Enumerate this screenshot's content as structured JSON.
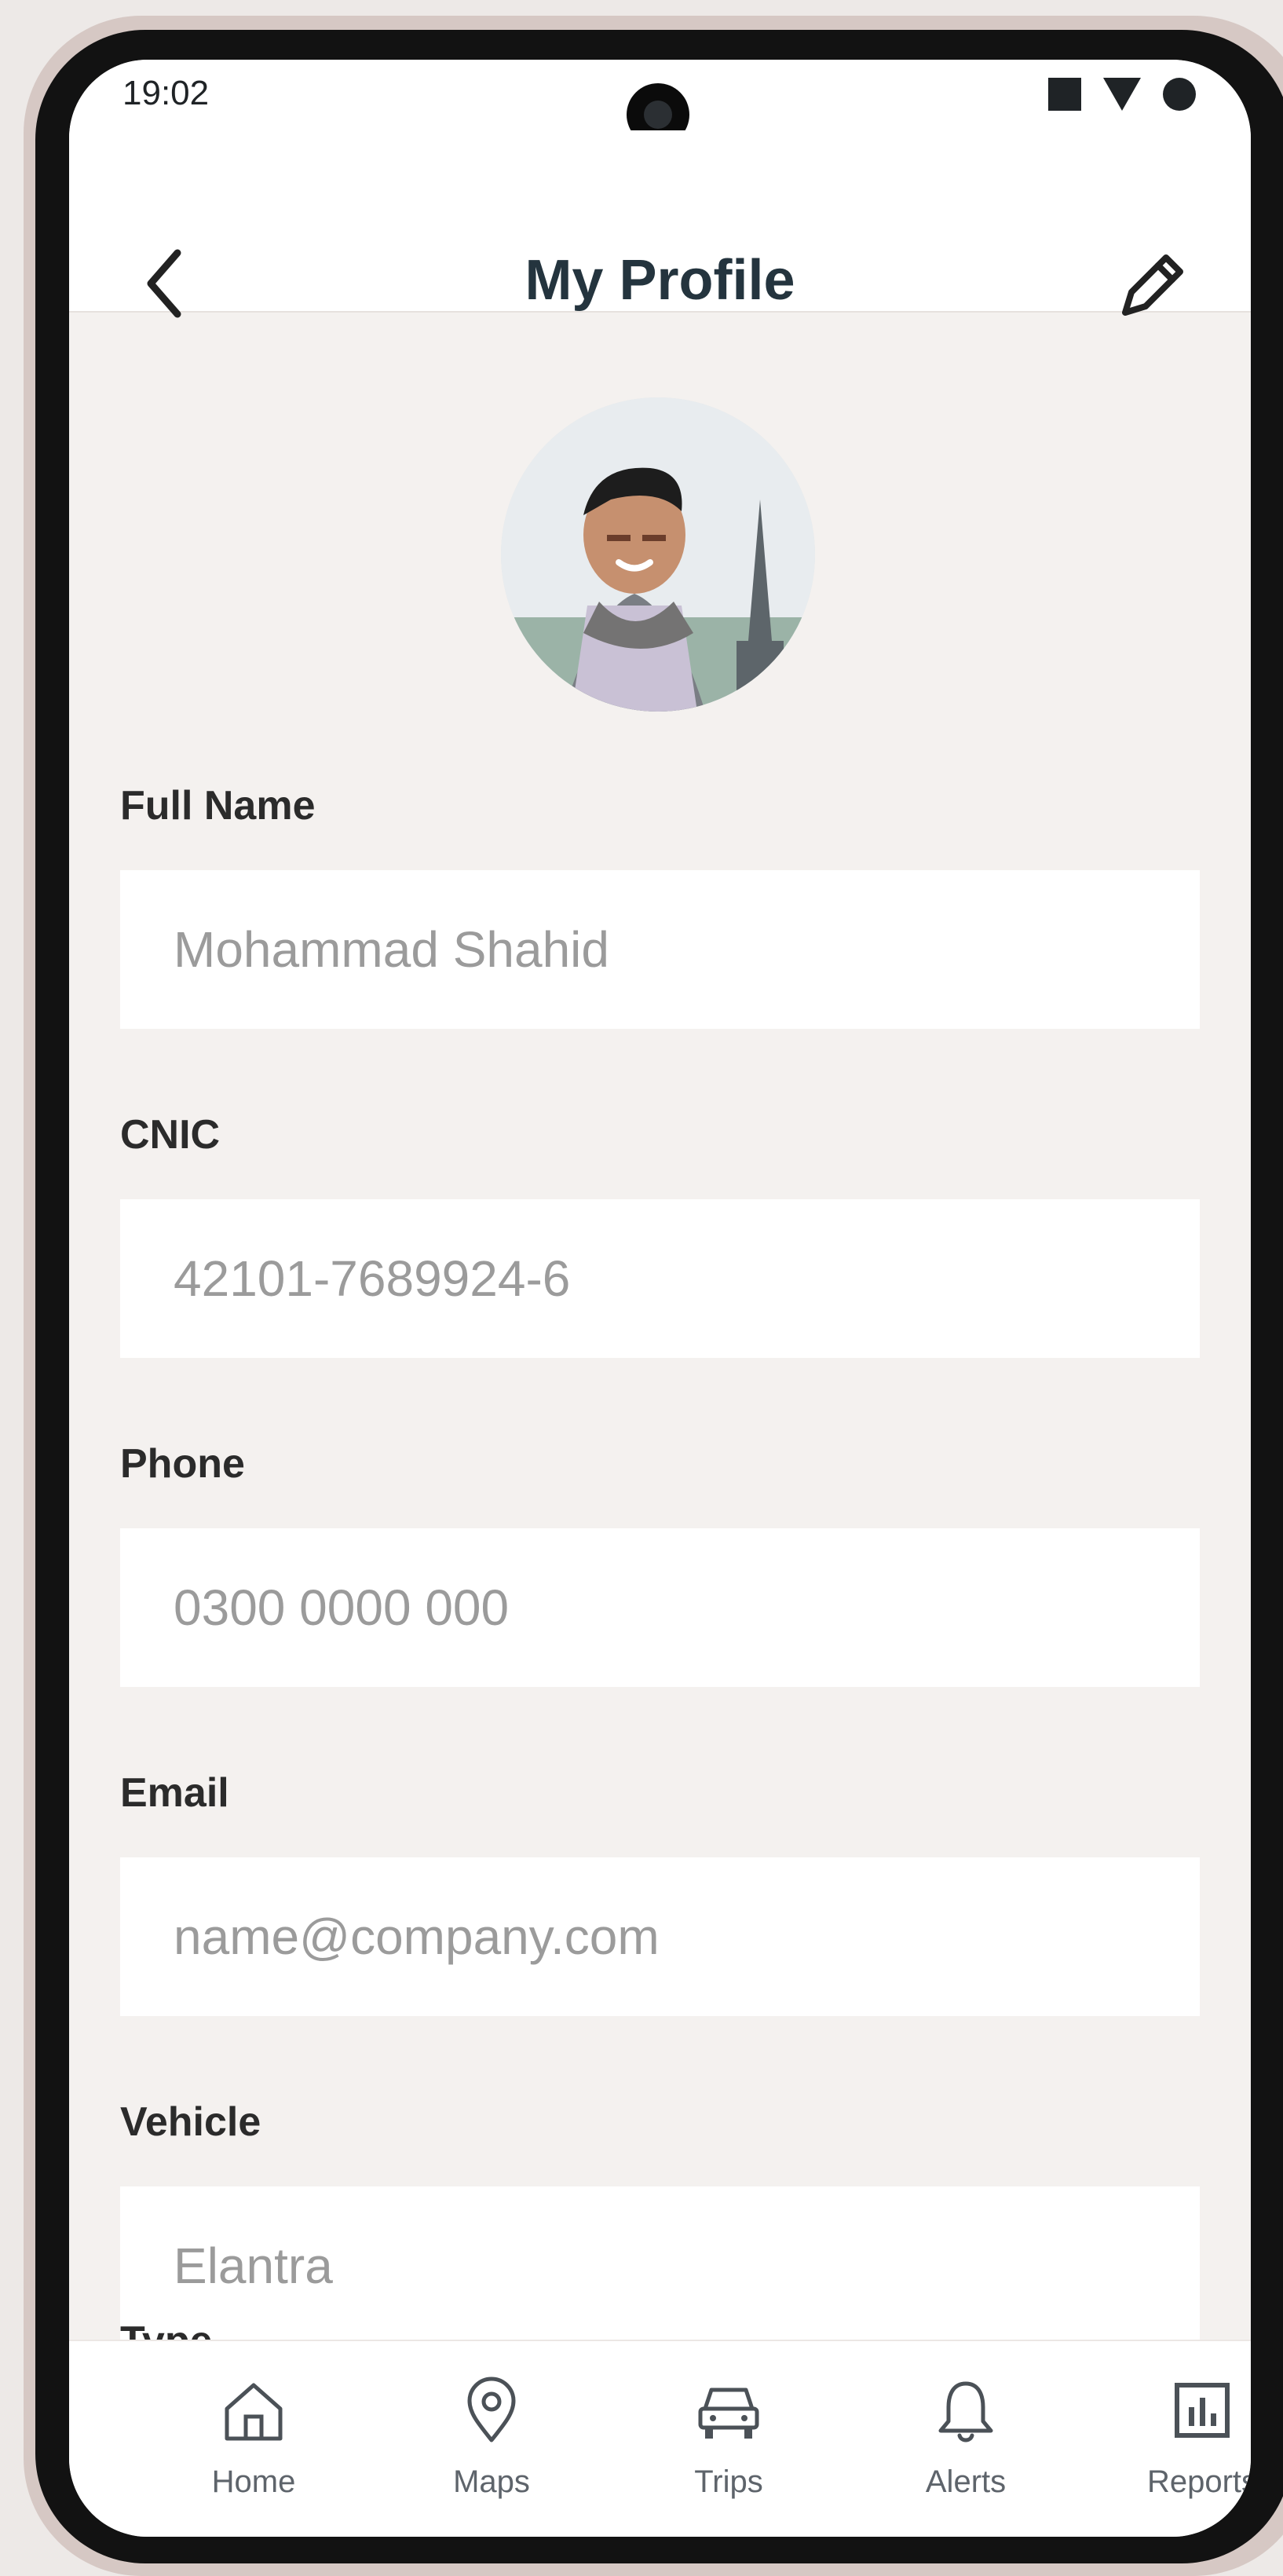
{
  "status_bar": {
    "time": "19:02"
  },
  "header": {
    "title": "My Profile"
  },
  "form": {
    "full_name": {
      "label": "Full Name",
      "placeholder": "Mohammad Shahid"
    },
    "cnic": {
      "label": "CNIC",
      "placeholder": "42101-7689924-6"
    },
    "phone": {
      "label": "Phone",
      "placeholder": "0300 0000 000"
    },
    "email": {
      "label": "Email",
      "placeholder": "name@company.com"
    },
    "vehicle": {
      "label": "Vehicle",
      "placeholder": "Elantra"
    },
    "type": {
      "label": "Type"
    }
  },
  "bottom_nav": {
    "items": [
      {
        "label": "Home",
        "icon": "home-icon"
      },
      {
        "label": "Maps",
        "icon": "map-pin-icon"
      },
      {
        "label": "Trips",
        "icon": "car-icon"
      },
      {
        "label": "Alerts",
        "icon": "bell-icon"
      },
      {
        "label": "Reports",
        "icon": "reports-icon"
      }
    ]
  },
  "colors": {
    "app_background": "#f4f1ef",
    "title_text": "#24343e",
    "label_text": "#2b2b2b",
    "placeholder_text": "#9a9a9a",
    "nav_text": "#5e646b"
  }
}
